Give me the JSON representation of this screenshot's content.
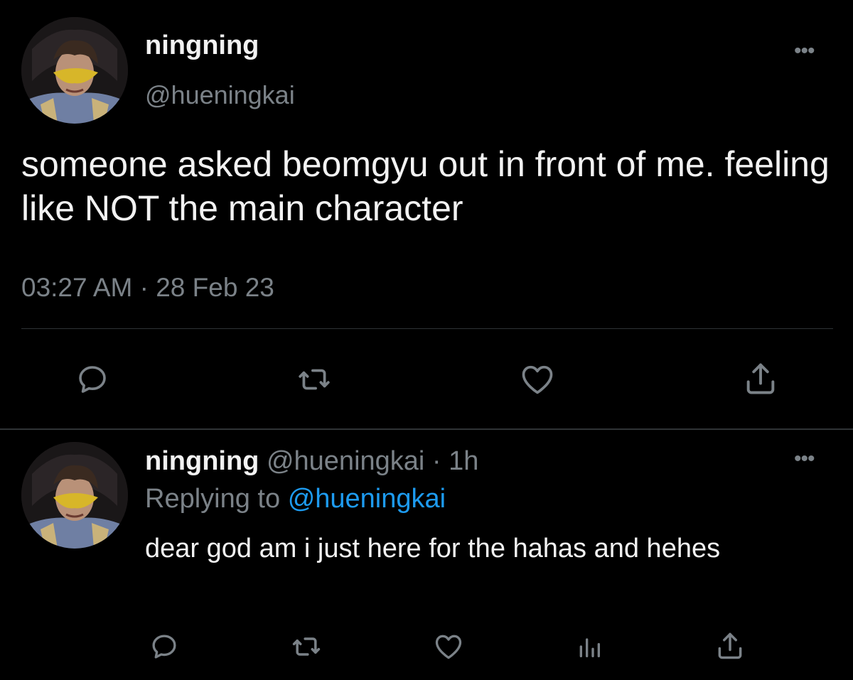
{
  "main_tweet": {
    "display_name": "ningning",
    "handle": "@hueningkai",
    "text": "someone asked beomgyu out in front of me. feeling like NOT the main character",
    "time": "03:27 AM",
    "separator": "·",
    "date": "28 Feb 23",
    "more_label": "•••",
    "actions": [
      "reply-icon",
      "retweet-icon",
      "like-icon",
      "share-icon"
    ]
  },
  "reply_tweet": {
    "display_name": "ningning",
    "handle": "@hueningkai",
    "separator": "·",
    "age": "1h",
    "replying_prefix": "Replying to",
    "replying_to": "@hueningkai",
    "text": "dear god am i just here for the hahas and hehes",
    "more_label": "•••",
    "actions": [
      "reply-icon",
      "retweet-icon",
      "like-icon",
      "analytics-icon",
      "share-icon"
    ]
  },
  "colors": {
    "background": "#000000",
    "primary_text": "#f2f2f2",
    "secondary_text": "#7b8288",
    "accent": "#1d9bf0",
    "divider": "#2f3336"
  }
}
